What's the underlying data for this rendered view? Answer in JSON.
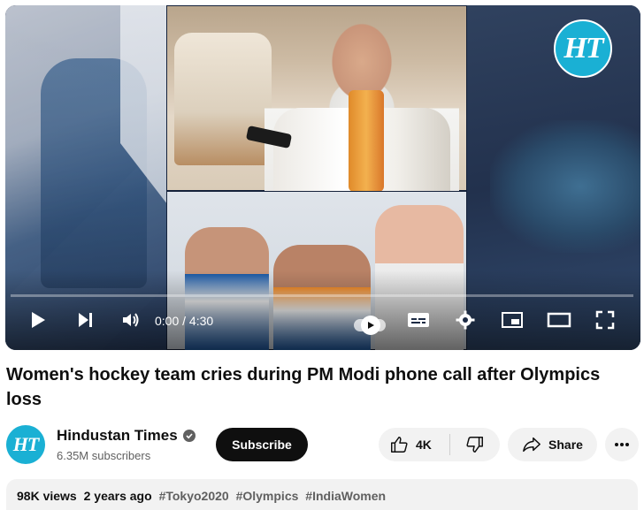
{
  "player": {
    "time_display": "0:00 / 4:30",
    "progress": 0,
    "logo_text": "HT"
  },
  "video": {
    "title": "Women's hockey team cries during PM Modi phone call after Olympics loss"
  },
  "channel": {
    "avatar_text": "HT",
    "name": "Hindustan Times",
    "subscribers": "6.35M subscribers"
  },
  "actions": {
    "subscribe_label": "Subscribe",
    "like_count": "4K",
    "share_label": "Share"
  },
  "description": {
    "views": "98K views",
    "age": "2 years ago",
    "hashtags": [
      "#Tokyo2020",
      "#Olympics",
      "#IndiaWomen"
    ]
  },
  "colors": {
    "accent": "#ff0000",
    "brand_ht": "#1ab0d4",
    "subscribe_bg": "#0f0f0f",
    "pill_bg": "#f2f2f2"
  },
  "icons": [
    "play-icon",
    "next-icon",
    "volume-icon",
    "autoplay-toggle-icon",
    "captions-icon",
    "settings-icon",
    "miniplayer-icon",
    "theater-icon",
    "fullscreen-icon",
    "verified-icon",
    "thumbs-up-icon",
    "thumbs-down-icon",
    "share-icon",
    "more-icon"
  ]
}
